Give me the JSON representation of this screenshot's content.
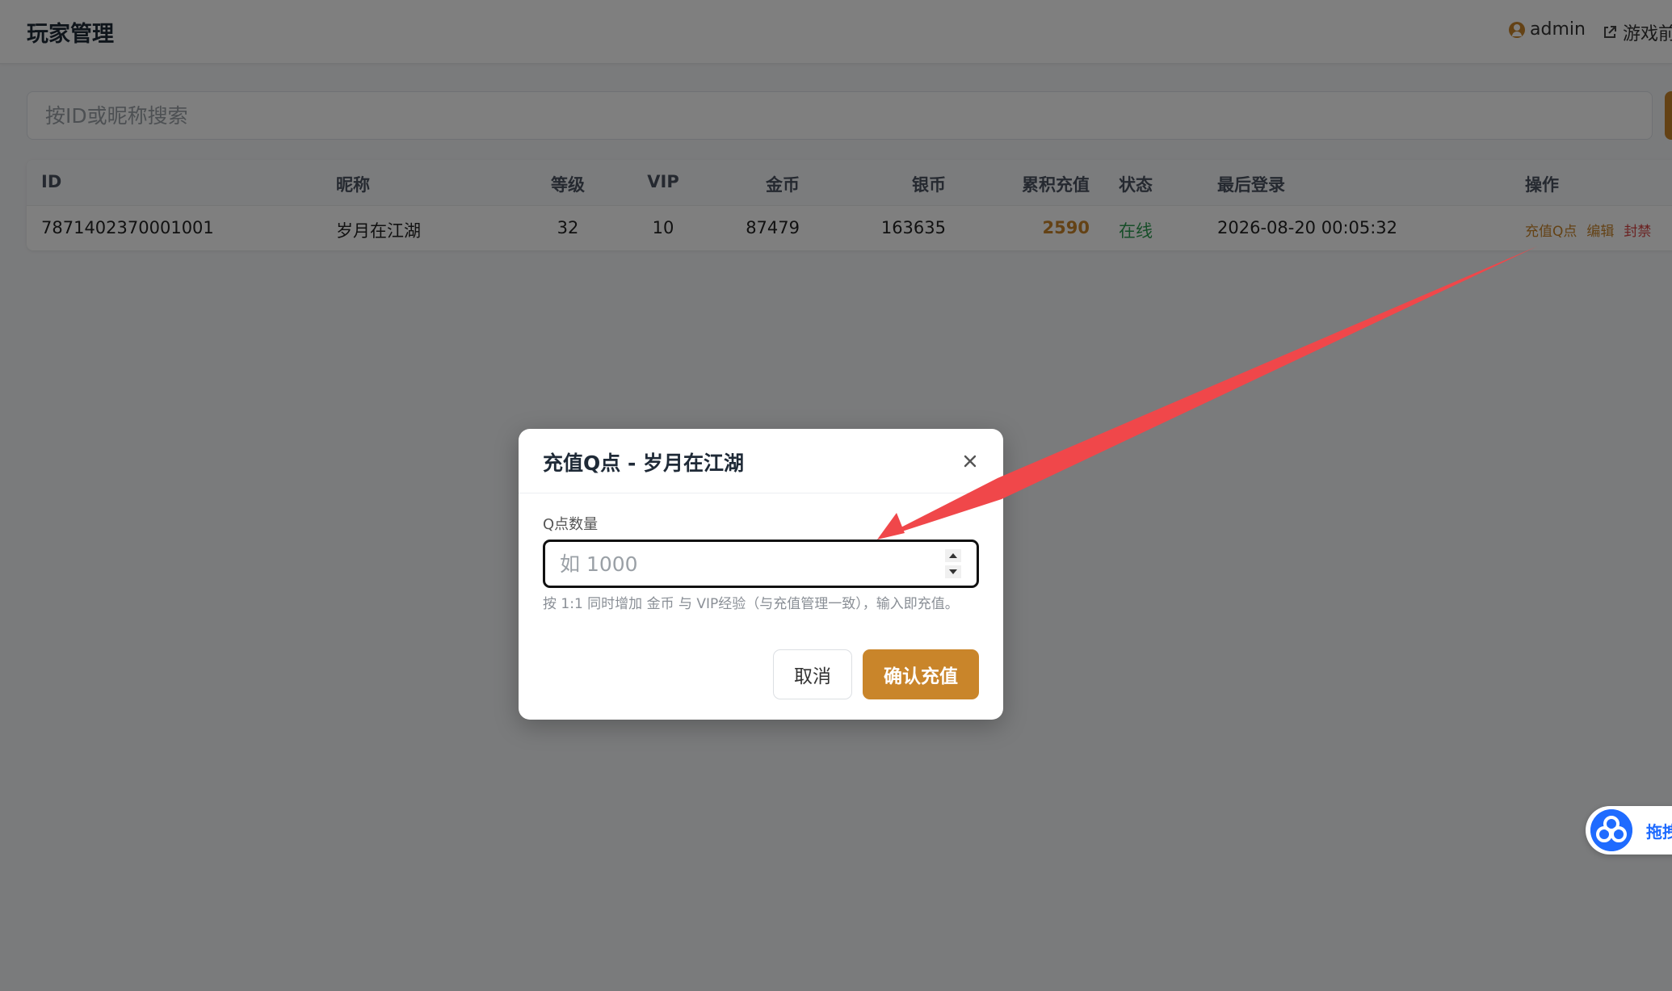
{
  "header": {
    "title": "玩家管理",
    "user": "admin",
    "front_link": "游戏前"
  },
  "search": {
    "placeholder": "按ID或昵称搜索",
    "value": ""
  },
  "table": {
    "columns": [
      "ID",
      "昵称",
      "等级",
      "VIP",
      "金币",
      "银币",
      "累积充值",
      "状态",
      "最后登录",
      "操作"
    ],
    "rows": [
      {
        "id": "7871402370001001",
        "nickname": "岁月在江湖",
        "level": "32",
        "vip": "10",
        "gold": "87479",
        "silver": "163635",
        "recharge": "2590",
        "status": "在线",
        "last_login": "2026-08-20 00:05:32",
        "actions": [
          "充值Q点",
          "编辑",
          "封禁"
        ]
      }
    ]
  },
  "modal": {
    "title": "充值Q点 - 岁月在江湖",
    "field_label": "Q点数量",
    "input_placeholder": "如 1000",
    "input_value": "",
    "hint": "按 1:1 同时增加 金币 与 VIP经验（与充值管理一致），输入即充值。",
    "cancel_label": "取消",
    "confirm_label": "确认充值"
  },
  "float_widget": {
    "label": "拖拽"
  },
  "colors": {
    "accent": "#c9852a",
    "online": "#2e9d52",
    "danger": "#d64545",
    "annotation_arrow": "#f0474a",
    "widget_blue": "#1f6bff"
  },
  "icons": [
    "user-circle-icon",
    "external-link-icon",
    "close-icon",
    "chevron-up-icon",
    "chevron-down-icon",
    "cloud-widget-icon"
  ]
}
